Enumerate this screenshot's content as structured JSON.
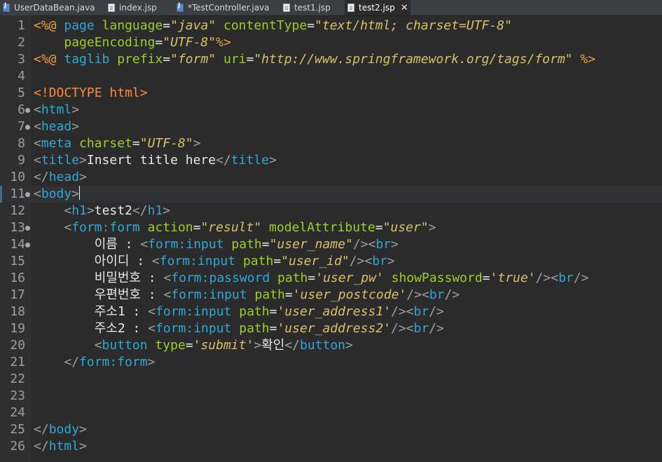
{
  "tabs": [
    {
      "label": "UserDataBean.java",
      "type": "java"
    },
    {
      "label": "index.jsp",
      "type": "jsp"
    },
    {
      "label": "*TestController.java",
      "type": "java"
    },
    {
      "label": "test1.jsp",
      "type": "jsp"
    },
    {
      "label": "test2.jsp",
      "type": "jsp",
      "active": true,
      "close": "✕"
    }
  ],
  "editor": {
    "current_line": 11,
    "lines": [
      {
        "n": "1",
        "fold": false,
        "tokens": [
          [
            "jsp",
            "<%@"
          ],
          [
            "plain",
            " "
          ],
          [
            "kw",
            "page"
          ],
          [
            "plain",
            " "
          ],
          [
            "attr",
            "language"
          ],
          [
            "plain",
            "="
          ],
          [
            "str",
            "\"java\""
          ],
          [
            "plain",
            " "
          ],
          [
            "attr",
            "contentType"
          ],
          [
            "plain",
            "="
          ],
          [
            "str",
            "\"text/html; charset=UTF-8\""
          ]
        ]
      },
      {
        "n": "2",
        "fold": false,
        "tokens": [
          [
            "plain",
            "    "
          ],
          [
            "attr",
            "pageEncoding"
          ],
          [
            "plain",
            "="
          ],
          [
            "str",
            "\"UTF-8\""
          ],
          [
            "jsp",
            "%>"
          ]
        ]
      },
      {
        "n": "3",
        "fold": false,
        "tokens": [
          [
            "jsp",
            "<%@"
          ],
          [
            "plain",
            " "
          ],
          [
            "kw",
            "taglib"
          ],
          [
            "plain",
            " "
          ],
          [
            "attr",
            "prefix"
          ],
          [
            "plain",
            "="
          ],
          [
            "str",
            "\"form\""
          ],
          [
            "plain",
            " "
          ],
          [
            "attr",
            "uri"
          ],
          [
            "plain",
            "="
          ],
          [
            "str",
            "\"http://www.springframework.org/tags/form\""
          ],
          [
            "plain",
            " "
          ],
          [
            "jsp",
            "%>"
          ]
        ]
      },
      {
        "n": "4",
        "fold": false,
        "tokens": []
      },
      {
        "n": "5",
        "fold": false,
        "tokens": [
          [
            "doctype",
            "<!DOCTYPE"
          ],
          [
            "plain",
            " "
          ],
          [
            "doctype",
            "html"
          ],
          [
            "doctype",
            ">"
          ]
        ]
      },
      {
        "n": "6",
        "fold": true,
        "tokens": [
          [
            "brk",
            "<"
          ],
          [
            "kw",
            "html"
          ],
          [
            "brk",
            ">"
          ]
        ]
      },
      {
        "n": "7",
        "fold": true,
        "tokens": [
          [
            "brk",
            "<"
          ],
          [
            "kw",
            "head"
          ],
          [
            "brk",
            ">"
          ]
        ]
      },
      {
        "n": "8",
        "fold": false,
        "tokens": [
          [
            "brk",
            "<"
          ],
          [
            "kw",
            "meta"
          ],
          [
            "plain",
            " "
          ],
          [
            "attr",
            "charset"
          ],
          [
            "plain",
            "="
          ],
          [
            "str",
            "\"UTF-8\""
          ],
          [
            "brk",
            ">"
          ]
        ]
      },
      {
        "n": "9",
        "fold": false,
        "tokens": [
          [
            "brk",
            "<"
          ],
          [
            "kw",
            "title"
          ],
          [
            "brk",
            ">"
          ],
          [
            "plain",
            "Insert title here"
          ],
          [
            "brk",
            "</"
          ],
          [
            "kw",
            "title"
          ],
          [
            "brk",
            ">"
          ]
        ]
      },
      {
        "n": "10",
        "fold": false,
        "tokens": [
          [
            "brk",
            "</"
          ],
          [
            "kw",
            "head"
          ],
          [
            "brk",
            ">"
          ]
        ]
      },
      {
        "n": "11",
        "fold": true,
        "tokens": [
          [
            "brk",
            "<"
          ],
          [
            "kw",
            "body"
          ],
          [
            "brk",
            ">"
          ]
        ]
      },
      {
        "n": "12",
        "fold": false,
        "tokens": [
          [
            "plain",
            "    "
          ],
          [
            "brk",
            "<"
          ],
          [
            "kw",
            "h1"
          ],
          [
            "brk",
            ">"
          ],
          [
            "plain",
            "test2"
          ],
          [
            "brk",
            "</"
          ],
          [
            "kw",
            "h1"
          ],
          [
            "brk",
            ">"
          ]
        ]
      },
      {
        "n": "13",
        "fold": true,
        "tokens": [
          [
            "plain",
            "    "
          ],
          [
            "brk",
            "<"
          ],
          [
            "kw",
            "form:form"
          ],
          [
            "plain",
            " "
          ],
          [
            "attr",
            "action"
          ],
          [
            "plain",
            "="
          ],
          [
            "str",
            "\"result\""
          ],
          [
            "plain",
            " "
          ],
          [
            "attr",
            "modelAttribute"
          ],
          [
            "plain",
            "="
          ],
          [
            "str",
            "\"user\""
          ],
          [
            "brk",
            ">"
          ]
        ]
      },
      {
        "n": "14",
        "fold": true,
        "tokens": [
          [
            "plain",
            "        이름 : "
          ],
          [
            "brk",
            "<"
          ],
          [
            "kw",
            "form:input"
          ],
          [
            "plain",
            " "
          ],
          [
            "attr",
            "path"
          ],
          [
            "plain",
            "="
          ],
          [
            "str",
            "\"user_name\""
          ],
          [
            "brk",
            "/><"
          ],
          [
            "kw",
            "br"
          ],
          [
            "brk",
            ">"
          ]
        ]
      },
      {
        "n": "15",
        "fold": false,
        "tokens": [
          [
            "plain",
            "        아이디 : "
          ],
          [
            "brk",
            "<"
          ],
          [
            "kw",
            "form:input"
          ],
          [
            "plain",
            " "
          ],
          [
            "attr",
            "path"
          ],
          [
            "plain",
            "="
          ],
          [
            "str",
            "\"user_id\""
          ],
          [
            "brk",
            "/><"
          ],
          [
            "kw",
            "br"
          ],
          [
            "brk",
            ">"
          ]
        ]
      },
      {
        "n": "16",
        "fold": false,
        "tokens": [
          [
            "plain",
            "        비밀번호 : "
          ],
          [
            "brk",
            "<"
          ],
          [
            "kw",
            "form:password"
          ],
          [
            "plain",
            " "
          ],
          [
            "attr",
            "path"
          ],
          [
            "plain",
            "="
          ],
          [
            "str",
            "'user_pw'"
          ],
          [
            "plain",
            " "
          ],
          [
            "attr",
            "showPassword"
          ],
          [
            "plain",
            "="
          ],
          [
            "str",
            "'true'"
          ],
          [
            "brk",
            "/><"
          ],
          [
            "kw",
            "br"
          ],
          [
            "brk",
            "/>"
          ]
        ]
      },
      {
        "n": "17",
        "fold": false,
        "tokens": [
          [
            "plain",
            "        우편번호 : "
          ],
          [
            "brk",
            "<"
          ],
          [
            "kw",
            "form:input"
          ],
          [
            "plain",
            " "
          ],
          [
            "attr",
            "path"
          ],
          [
            "plain",
            "="
          ],
          [
            "str",
            "'user_postcode'"
          ],
          [
            "brk",
            "/><"
          ],
          [
            "kw",
            "br"
          ],
          [
            "brk",
            "/>"
          ]
        ]
      },
      {
        "n": "18",
        "fold": false,
        "tokens": [
          [
            "plain",
            "        주소1 : "
          ],
          [
            "brk",
            "<"
          ],
          [
            "kw",
            "form:input"
          ],
          [
            "plain",
            " "
          ],
          [
            "attr",
            "path"
          ],
          [
            "plain",
            "="
          ],
          [
            "str",
            "'user_address1'"
          ],
          [
            "brk",
            "/><"
          ],
          [
            "kw",
            "br"
          ],
          [
            "brk",
            "/>"
          ]
        ]
      },
      {
        "n": "19",
        "fold": false,
        "tokens": [
          [
            "plain",
            "        주소2 : "
          ],
          [
            "brk",
            "<"
          ],
          [
            "kw",
            "form:input"
          ],
          [
            "plain",
            " "
          ],
          [
            "attr",
            "path"
          ],
          [
            "plain",
            "="
          ],
          [
            "str",
            "'user_address2'"
          ],
          [
            "brk",
            "/><"
          ],
          [
            "kw",
            "br"
          ],
          [
            "brk",
            "/>"
          ]
        ]
      },
      {
        "n": "20",
        "fold": false,
        "tokens": [
          [
            "plain",
            "        "
          ],
          [
            "brk",
            "<"
          ],
          [
            "kw",
            "button"
          ],
          [
            "plain",
            " "
          ],
          [
            "attr",
            "type"
          ],
          [
            "plain",
            "="
          ],
          [
            "str",
            "'submit'"
          ],
          [
            "brk",
            ">"
          ],
          [
            "plain",
            "확인"
          ],
          [
            "brk",
            "</"
          ],
          [
            "kw",
            "button"
          ],
          [
            "brk",
            ">"
          ]
        ]
      },
      {
        "n": "21",
        "fold": false,
        "tokens": [
          [
            "plain",
            "    "
          ],
          [
            "brk",
            "</"
          ],
          [
            "kw",
            "form:form"
          ],
          [
            "brk",
            ">"
          ]
        ]
      },
      {
        "n": "22",
        "fold": false,
        "tokens": []
      },
      {
        "n": "23",
        "fold": false,
        "tokens": []
      },
      {
        "n": "24",
        "fold": false,
        "tokens": []
      },
      {
        "n": "25",
        "fold": false,
        "tokens": [
          [
            "brk",
            "</"
          ],
          [
            "kw",
            "body"
          ],
          [
            "brk",
            ">"
          ]
        ]
      },
      {
        "n": "26",
        "fold": false,
        "tokens": [
          [
            "brk",
            "</"
          ],
          [
            "kw",
            "html"
          ],
          [
            "brk",
            ">"
          ]
        ]
      }
    ]
  }
}
